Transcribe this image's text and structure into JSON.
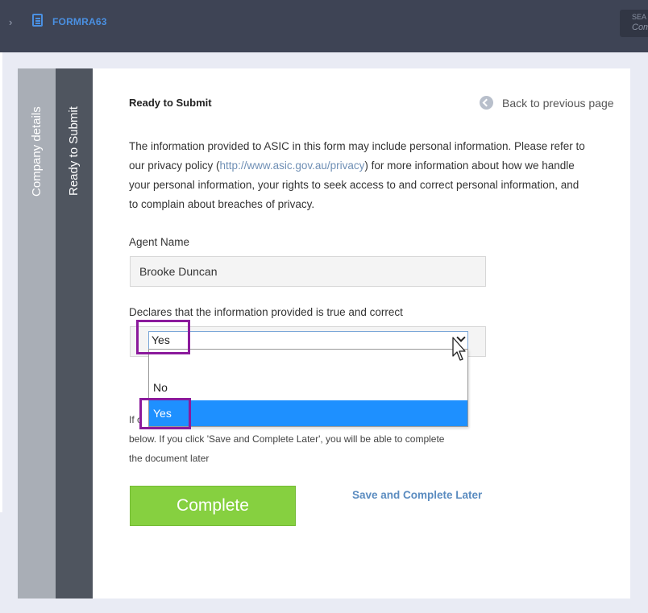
{
  "header": {
    "form_code": "FORMRA63",
    "search_label": "SEA",
    "search_sub": "Com"
  },
  "sidebar": {
    "tabs": [
      {
        "label": "Company details"
      },
      {
        "label": "Ready to Submit"
      }
    ]
  },
  "main": {
    "title": "Ready to Submit",
    "back_link": "Back to previous page",
    "info_before_link": "The information provided to ASIC in this form may include personal information. Please refer to our privacy policy (",
    "info_link": "http://www.asic.gov.au/privacy",
    "info_after_link": ") for more information about how we handle your personal information, your rights to seek access to and correct personal information, and to complain about breaches of privacy.",
    "agent_label": "Agent Name",
    "agent_value": "Brooke Duncan",
    "declaration_label": "Declares that the information provided is true and correct",
    "declaration_selected": "Yes",
    "declaration_options": [
      "",
      "No",
      "Yes"
    ],
    "instructions_line1_start": "If c",
    "instructions_line2": "below. If you click 'Save and Complete Later', you will be able to complete",
    "instructions_line3": "the document later",
    "complete_button": "Complete",
    "save_later_link": "Save and Complete Later"
  },
  "colors": {
    "topbar": "#3e4455",
    "accent_blue": "#4a90e2",
    "complete_green": "#86d040",
    "highlight_purple": "#8b1a9c",
    "selected_option": "#1e90ff"
  }
}
